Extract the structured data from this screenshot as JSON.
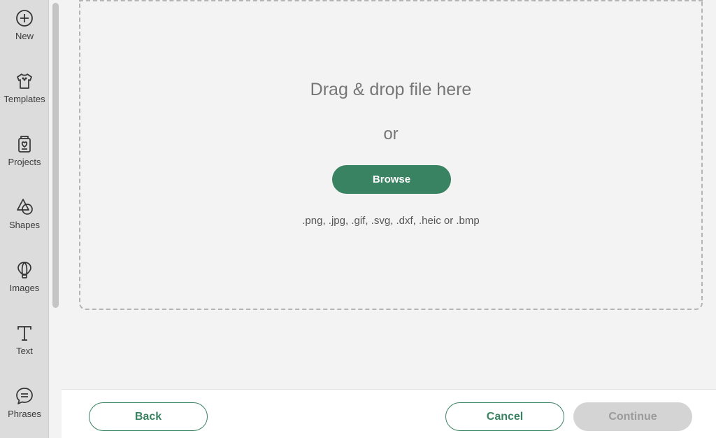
{
  "sidebar": {
    "items": [
      {
        "label": "New",
        "icon": "plus-circle-icon"
      },
      {
        "label": "Templates",
        "icon": "tshirt-icon"
      },
      {
        "label": "Projects",
        "icon": "project-heart-icon"
      },
      {
        "label": "Shapes",
        "icon": "shapes-icon"
      },
      {
        "label": "Images",
        "icon": "balloon-icon"
      },
      {
        "label": "Text",
        "icon": "text-t-icon"
      },
      {
        "label": "Phrases",
        "icon": "speech-bubble-icon"
      }
    ]
  },
  "dropzone": {
    "title": "Drag & drop file here",
    "or": "or",
    "browse_label": "Browse",
    "filetypes": ".png, .jpg, .gif, .svg, .dxf, .heic or .bmp"
  },
  "footer": {
    "back_label": "Back",
    "cancel_label": "Cancel",
    "continue_label": "Continue"
  },
  "colors": {
    "accent": "#3a8362",
    "disabled": "#d4d4d4"
  }
}
